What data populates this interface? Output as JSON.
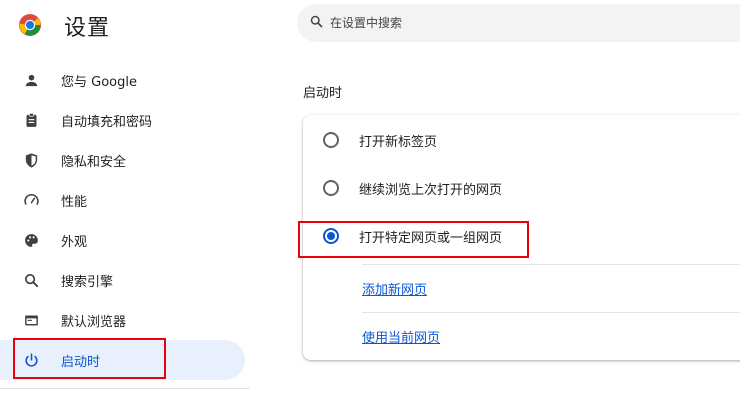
{
  "header": {
    "title": "设置",
    "logo": "chrome-logo"
  },
  "search": {
    "placeholder": "在设置中搜索",
    "icon": "search-icon"
  },
  "sidebar": {
    "items": [
      {
        "label": "您与 Google",
        "icon": "person-icon",
        "active": false
      },
      {
        "label": "自动填充和密码",
        "icon": "clipboard-icon",
        "active": false
      },
      {
        "label": "隐私和安全",
        "icon": "shield-icon",
        "active": false
      },
      {
        "label": "性能",
        "icon": "speedometer-icon",
        "active": false
      },
      {
        "label": "外观",
        "icon": "palette-icon",
        "active": false
      },
      {
        "label": "搜索引擎",
        "icon": "search-icon",
        "active": false
      },
      {
        "label": "默认浏览器",
        "icon": "browser-icon",
        "active": false
      },
      {
        "label": "启动时",
        "icon": "power-icon",
        "active": true
      }
    ]
  },
  "main": {
    "section_title": "启动时",
    "options": [
      {
        "label": "打开新标签页",
        "checked": false
      },
      {
        "label": "继续浏览上次打开的网页",
        "checked": false
      },
      {
        "label": "打开特定网页或一组网页",
        "checked": true
      }
    ],
    "links": {
      "add_page": "添加新网页",
      "use_current": "使用当前网页"
    }
  },
  "colors": {
    "accent": "#0b57d0",
    "active_bg": "#e8f0fe",
    "highlight": "#e8000b"
  }
}
